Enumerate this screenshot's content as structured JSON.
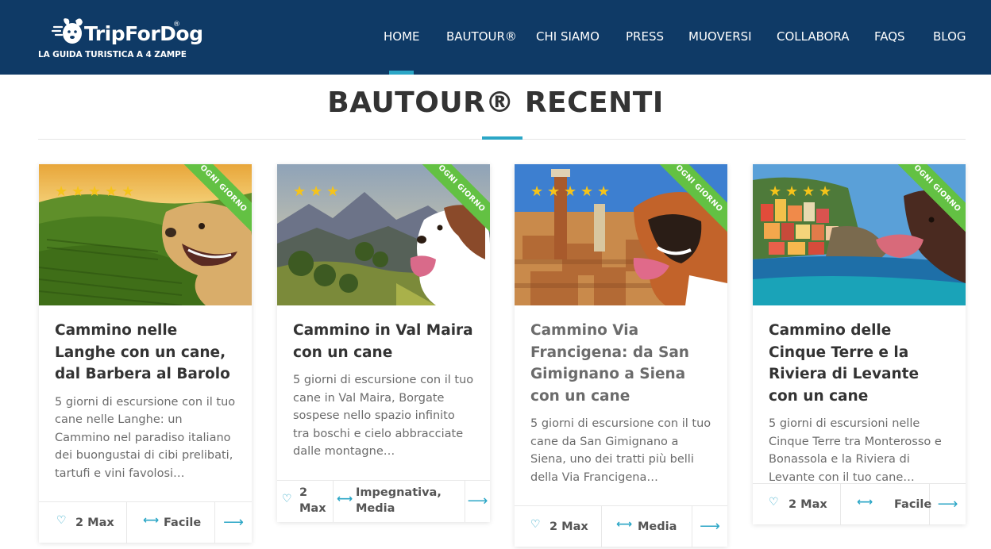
{
  "brand": {
    "name": "TripForDog",
    "reg": "®",
    "tagline": "LA GUIDA TURISTICA A 4 ZAMPE"
  },
  "nav": {
    "items": [
      "HOME",
      "BAUTOUR®",
      "CHI SIAMO",
      "PRESS",
      "MUOVERSI",
      "COLLABORA",
      "FAQS",
      "BLOG"
    ],
    "active": "HOME"
  },
  "section": {
    "title": "BAUTOUR® RECENTI"
  },
  "colors": {
    "header_bg": "#0f3a66",
    "accent": "#2ba6c6",
    "ribbon": "#63c143",
    "star": "#f5c31a"
  },
  "cards": [
    {
      "ribbon": "OGNI GIORNO",
      "rating": 5,
      "title": "Cammino nelle Langhe con un cane, dal Barbera al Barolo",
      "description": "5 giorni di escursione con il tuo cane nelle Langhe: un Cammino nel paradiso italiano dei buongustai di cibi prelibati, tartufi e vini favolosi…",
      "dogs": "2 Max",
      "difficulty": "Facile",
      "icons": {
        "dogs": "dog-bowl-icon",
        "difficulty": "dumbbell-icon",
        "arrow": "arrow-right-icon"
      }
    },
    {
      "ribbon": "OGNI GIORNO",
      "rating": 3,
      "title": "Cammino in Val Maira con un cane",
      "description": "5 giorni di escursione con il tuo cane in Val Maira, Borgate sospese nello spazio infinito tra boschi e cielo abbracciate dalle montagne…",
      "dogs": "2 Max",
      "difficulty": "Impegnativa, Media",
      "icons": {
        "dogs": "dog-bowl-icon",
        "difficulty": "dumbbell-icon",
        "arrow": "arrow-right-icon"
      }
    },
    {
      "ribbon": "OGNI GIORNO",
      "rating": 5,
      "title": "Cammino Via Francigena: da San Gimignano a Siena con un cane",
      "description": "5 giorni di escursione con il tuo cane da San Gimignano a Siena, uno dei tratti più belli della Via Francigena…",
      "dogs": "2 Max",
      "difficulty": "Media",
      "icons": {
        "dogs": "dog-bowl-icon",
        "difficulty": "dumbbell-icon",
        "arrow": "arrow-right-icon"
      }
    },
    {
      "ribbon": "OGNI GIORNO",
      "rating": 4,
      "title": "Cammino delle Cinque Terre e la Riviera di Levante con un cane",
      "description": "5 giorni di escursioni nelle Cinque Terre tra Monterosso e Bonassola e la Riviera di Levante con il tuo cane…",
      "dogs": "2 Max",
      "difficulty": "Facile",
      "icons": {
        "dogs": "dog-bowl-icon",
        "difficulty": "dumbbell-icon",
        "arrow": "arrow-right-icon"
      }
    }
  ]
}
